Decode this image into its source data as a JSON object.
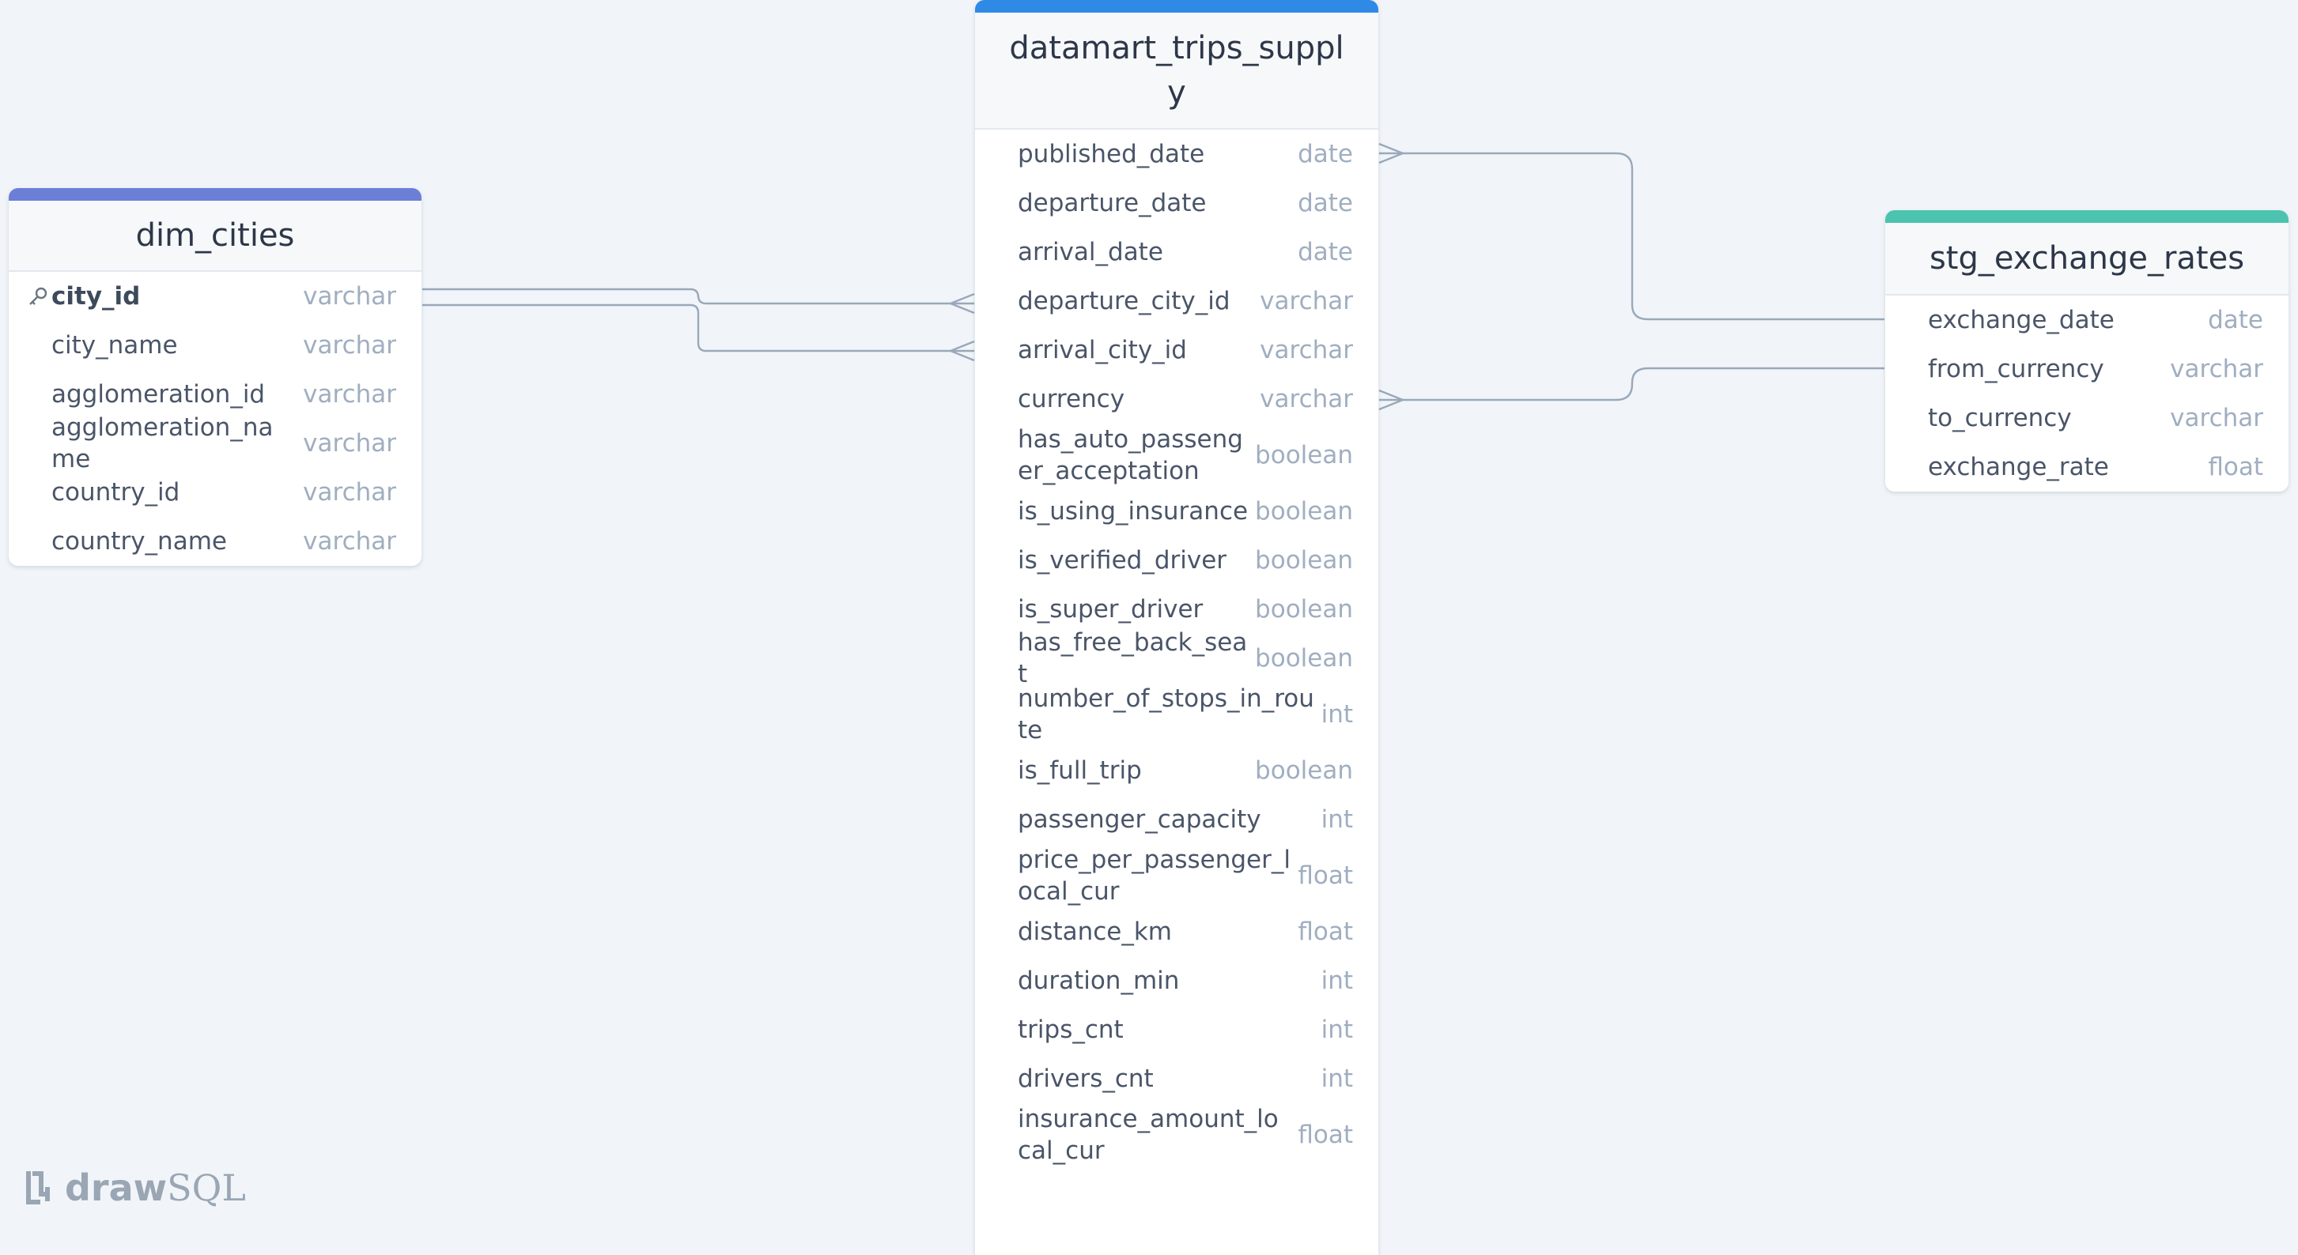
{
  "logo": {
    "draw": "draw",
    "sql": "SQL"
  },
  "colors": {
    "background": "#f1f5f9",
    "dim_cities_accent": "#6b7fd6",
    "trips_accent": "#2f8ae6",
    "exchange_accent": "#4cc3ae",
    "edge": "#9aa8ba"
  },
  "tables": {
    "dim_cities": {
      "name": "dim_cities",
      "columns": [
        {
          "name": "city_id",
          "type": "varchar",
          "pk": true
        },
        {
          "name": "city_name",
          "type": "varchar"
        },
        {
          "name": "agglomeration_id",
          "type": "varchar"
        },
        {
          "name": "agglomeration_name",
          "type": "varchar"
        },
        {
          "name": "country_id",
          "type": "varchar"
        },
        {
          "name": "country_name",
          "type": "varchar"
        }
      ]
    },
    "trips": {
      "name": "datamart_trips_supply",
      "columns": [
        {
          "name": "published_date",
          "type": "date"
        },
        {
          "name": "departure_date",
          "type": "date"
        },
        {
          "name": "arrival_date",
          "type": "date"
        },
        {
          "name": "departure_city_id",
          "type": "varchar"
        },
        {
          "name": "arrival_city_id",
          "type": "varchar"
        },
        {
          "name": "currency",
          "type": "varchar"
        },
        {
          "name": "has_auto_passenger_acceptation",
          "type": "boolean"
        },
        {
          "name": "is_using_insurance",
          "type": "boolean"
        },
        {
          "name": "is_verified_driver",
          "type": "boolean"
        },
        {
          "name": "is_super_driver",
          "type": "boolean"
        },
        {
          "name": "has_free_back_seat",
          "type": "boolean"
        },
        {
          "name": "number_of_stops_in_route",
          "type": "int"
        },
        {
          "name": "is_full_trip",
          "type": "boolean"
        },
        {
          "name": "passenger_capacity",
          "type": "int"
        },
        {
          "name": "price_per_passenger_local_cur",
          "type": "float"
        },
        {
          "name": "distance_km",
          "type": "float"
        },
        {
          "name": "duration_min",
          "type": "int"
        },
        {
          "name": "trips_cnt",
          "type": "int"
        },
        {
          "name": "drivers_cnt",
          "type": "int"
        },
        {
          "name": "insurance_amount_local_cur",
          "type": "float"
        }
      ]
    },
    "exchange": {
      "name": "stg_exchange_rates",
      "columns": [
        {
          "name": "exchange_date",
          "type": "date"
        },
        {
          "name": "from_currency",
          "type": "varchar"
        },
        {
          "name": "to_currency",
          "type": "varchar"
        },
        {
          "name": "exchange_rate",
          "type": "float"
        }
      ]
    }
  }
}
